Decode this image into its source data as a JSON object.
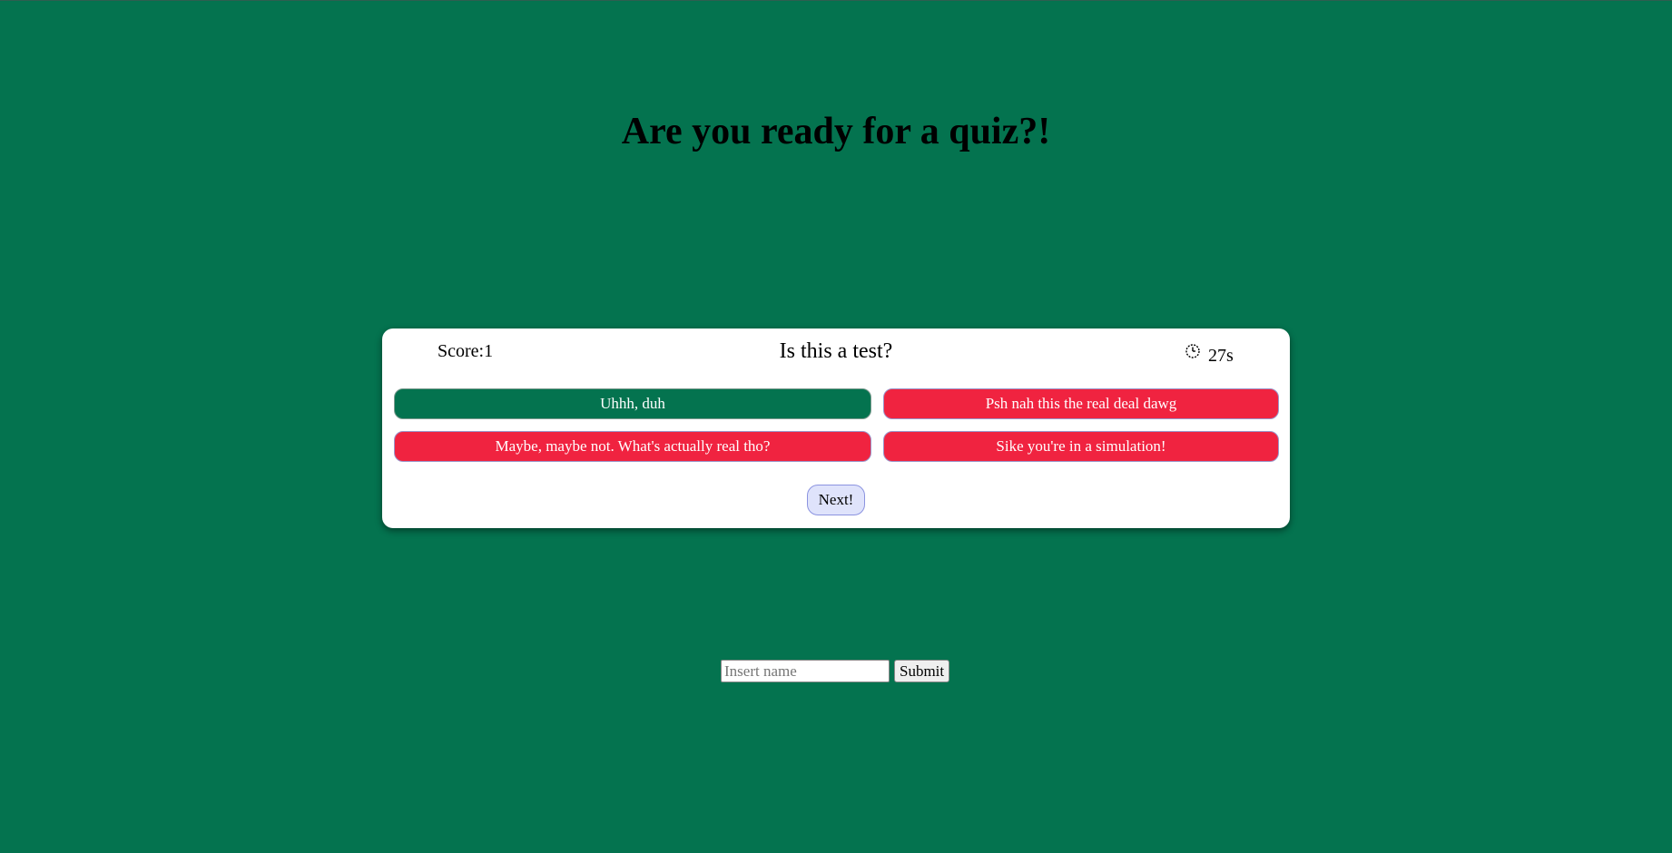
{
  "page": {
    "title": "Are you ready for a quiz?!",
    "background_color": "#04734f"
  },
  "quiz": {
    "score_label": "Score:1",
    "question": "Is this a test?",
    "timer_icon": "clock-icon",
    "timer_text": "27s",
    "answers": [
      {
        "label": "Uhhh, duh",
        "state": "correct",
        "color": "#04734f"
      },
      {
        "label": "Psh nah this the real deal dawg",
        "state": "wrong",
        "color": "#f02340"
      },
      {
        "label": "Maybe, maybe not. What's actually real tho?",
        "state": "wrong",
        "color": "#f02340"
      },
      {
        "label": "Sike you're in a simulation!",
        "state": "wrong",
        "color": "#f02340"
      }
    ],
    "next_label": "Next!"
  },
  "form": {
    "name_placeholder": "Insert name",
    "name_value": "",
    "submit_label": "Submit"
  }
}
